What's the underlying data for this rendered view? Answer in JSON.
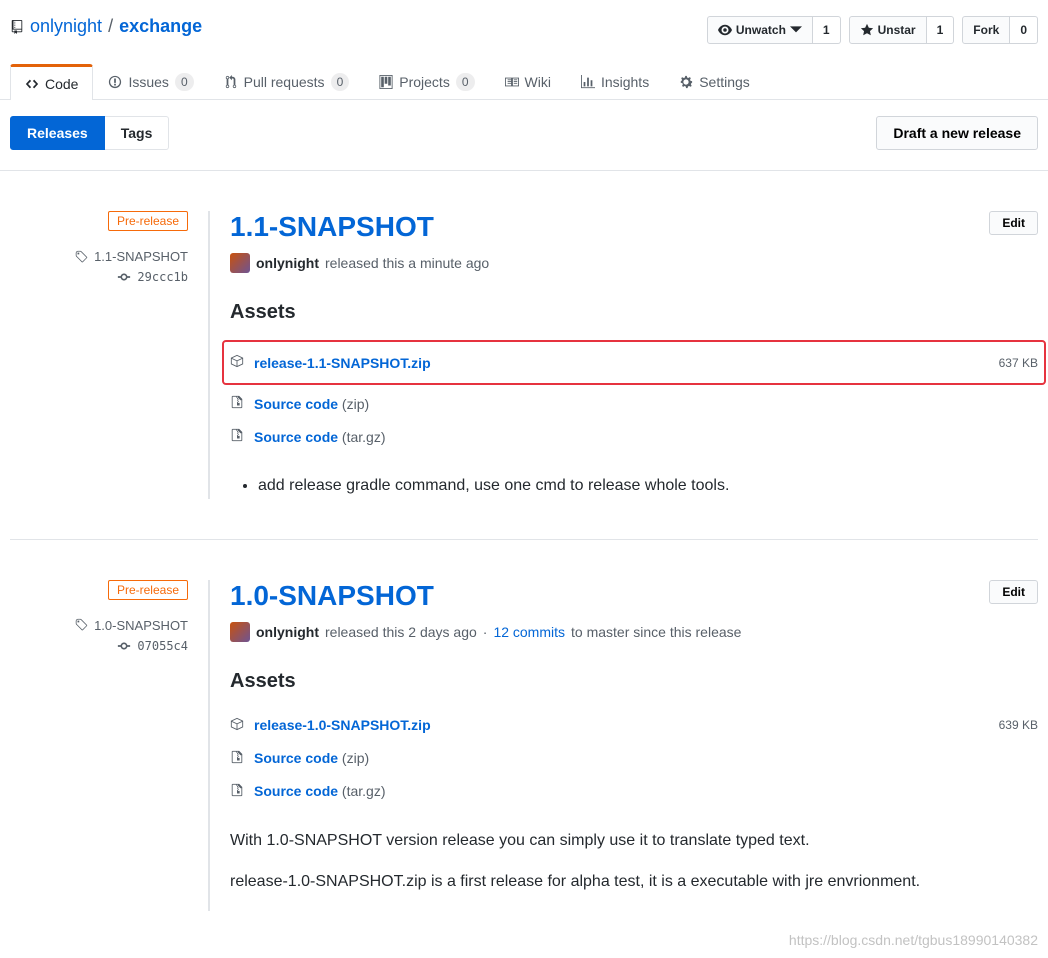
{
  "repo": {
    "owner": "onlynight",
    "name": "exchange"
  },
  "actions": {
    "watch": {
      "label": "Unwatch",
      "count": "1"
    },
    "star": {
      "label": "Unstar",
      "count": "1"
    },
    "fork": {
      "label": "Fork",
      "count": "0"
    }
  },
  "tabs": {
    "code": "Code",
    "issues": {
      "label": "Issues",
      "count": "0"
    },
    "pulls": {
      "label": "Pull requests",
      "count": "0"
    },
    "projects": {
      "label": "Projects",
      "count": "0"
    },
    "wiki": "Wiki",
    "insights": "Insights",
    "settings": "Settings"
  },
  "subnav": {
    "releases": "Releases",
    "tags": "Tags",
    "draft": "Draft a new release"
  },
  "releases": [
    {
      "badge": "Pre-release",
      "tag": "1.1-SNAPSHOT",
      "commit": "29ccc1b",
      "title": "1.1-SNAPSHOT",
      "edit": "Edit",
      "author": "onlynight",
      "byline": "released this a minute ago",
      "assets_title": "Assets",
      "assets": [
        {
          "name": "release-1.1-SNAPSHOT.zip",
          "size": "637 KB",
          "type": "package",
          "highlight": true
        },
        {
          "name": "Source code",
          "ext": "(zip)",
          "type": "zip"
        },
        {
          "name": "Source code",
          "ext": "(tar.gz)",
          "type": "zip"
        }
      ],
      "notes_list": [
        "add release gradle command, use one cmd to release whole tools."
      ]
    },
    {
      "badge": "Pre-release",
      "tag": "1.0-SNAPSHOT",
      "commit": "07055c4",
      "title": "1.0-SNAPSHOT",
      "edit": "Edit",
      "author": "onlynight",
      "byline": "released this 2 days ago",
      "commits_since": "12 commits",
      "commits_since_suffix": "to master since this release",
      "assets_title": "Assets",
      "assets": [
        {
          "name": "release-1.0-SNAPSHOT.zip",
          "size": "639 KB",
          "type": "package"
        },
        {
          "name": "Source code",
          "ext": "(zip)",
          "type": "zip"
        },
        {
          "name": "Source code",
          "ext": "(tar.gz)",
          "type": "zip"
        }
      ],
      "notes_para": [
        "With 1.0-SNAPSHOT version release you can simply use it to translate typed text.",
        "release-1.0-SNAPSHOT.zip is a first release for alpha test, it is a executable with jre envrionment."
      ]
    }
  ],
  "watermark": "https://blog.csdn.net/tgbus18990140382"
}
